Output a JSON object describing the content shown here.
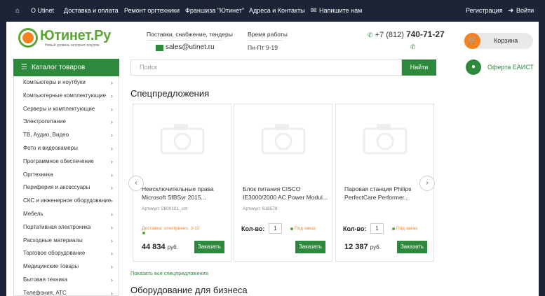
{
  "topbar": {
    "home_icon": "home-icon",
    "links": [
      "О Utinet",
      "Доставка и оплата",
      "Ремонт оргтехники",
      "Франшиза \"Ютинет\"",
      "Адреса и Контакты"
    ],
    "write_us": "Напишите нам",
    "register": "Регистрация",
    "login": "Войти"
  },
  "header": {
    "logo": "Ютинет.Ру",
    "logo_sub": "Новый уровень интернет-покупок",
    "supply_title": "Поставки, снабжение, тендеры",
    "email": "sales@utinet.ru",
    "hours_title": "Время работы",
    "hours": "Пн-Пт 9-19",
    "phone_prefix": "+7 (812)",
    "phone_number": "740-71-27",
    "cart": "Корзина",
    "eaist": "Оферта ЕАИСТ"
  },
  "catalog": {
    "title": "Каталог товаров",
    "items": [
      "Компьютеры и ноутбуки",
      "Компьютерные комплектующие",
      "Серверы и комплектующие",
      "Электропитание",
      "ТВ, Аудио, Видео",
      "Фото и видеокамеры",
      "Программное обеспечение",
      "Оргтехника",
      "Периферия и аксессуары",
      "СКС и инженерное оборудование",
      "Мебель",
      "Портативная электроника",
      "Расходные материалы",
      "Торговое оборудование",
      "Медицинские товары",
      "Бытовая техника",
      "Телефония, АТС"
    ]
  },
  "search": {
    "placeholder": "Поиск",
    "button": "Найти"
  },
  "specials": {
    "title": "Спецпредложения",
    "show_all": "Показать все спецпредложения",
    "cards": [
      {
        "name": "Неисключительные права Microsoft SfBSvr 2015...",
        "article": "Артикул: 2800101_cnt",
        "delivery": "Доставка: электронно, 3-10",
        "price": "44 834",
        "currency": "руб.",
        "button": "Заказать"
      },
      {
        "name": "Блок питания CISCO IE3000/2000 AC Power Modul...",
        "article": "Артикул: 616578",
        "qty_label": "Кол-во:",
        "qty": "1",
        "stock": "Под заказ",
        "price": "",
        "currency": "",
        "button": "Заказать"
      },
      {
        "name": "Паровая станция Philips PerfectCare Performer...",
        "article": "",
        "qty_label": "Кол-во:",
        "qty": "1",
        "stock": "Под заказ",
        "price": "12 387",
        "currency": "руб.",
        "button": "Заказать"
      }
    ]
  },
  "business": {
    "title": "Оборудование для бизнеса"
  },
  "colors": {
    "green": "#2d8a3c",
    "orange": "#f58220",
    "topbar": "#1c2436"
  }
}
